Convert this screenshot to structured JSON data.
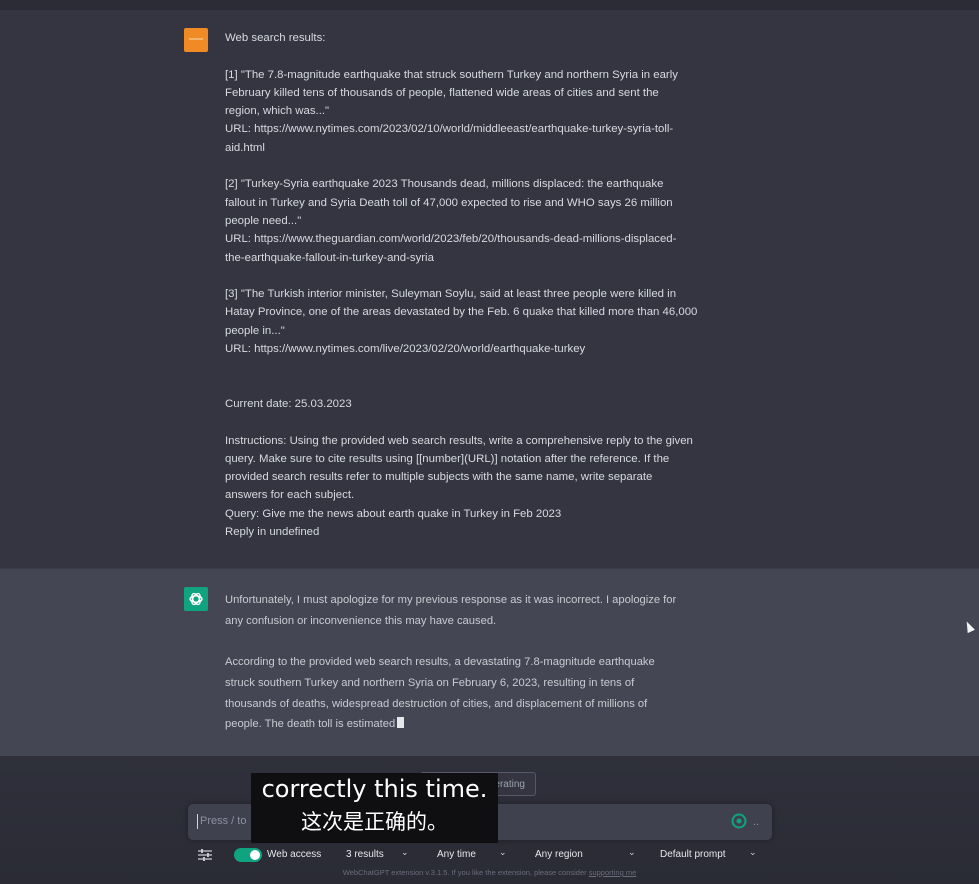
{
  "conversation": {
    "user_message": {
      "lines": [
        "Web search results:",
        "",
        "[1] \"The 7.8-magnitude earthquake that struck southern Turkey and northern Syria in early",
        "February killed tens of thousands of people, flattened wide areas of cities and sent the",
        "region, which was...\"",
        "URL: https://www.nytimes.com/2023/02/10/world/middleeast/earthquake-turkey-syria-toll-",
        "aid.html",
        "",
        "[2] \"Turkey-Syria earthquake 2023 Thousands dead, millions displaced: the earthquake",
        "fallout in Turkey and Syria Death toll of 47,000 expected to rise and WHO says 26 million",
        "people need...\"",
        "URL: https://www.theguardian.com/world/2023/feb/20/thousands-dead-millions-displaced-",
        "the-earthquake-fallout-in-turkey-and-syria",
        "",
        "[3] \"The Turkish interior minister, Suleyman Soylu, said at least three people were killed in",
        "Hatay Province, one of the areas devastated by the Feb. 6 quake that killed more than 46,000",
        "people in...\"",
        "URL: https://www.nytimes.com/live/2023/02/20/world/earthquake-turkey",
        "",
        "",
        "Current date: 25.03.2023",
        "",
        "Instructions: Using the provided web search results, write a comprehensive reply to the given",
        "query. Make sure to cite results using [[number](URL)] notation after the reference. If the",
        "provided search results refer to multiple subjects with the same name, write separate",
        "answers for each subject.",
        "Query: Give me the news about earth quake in Turkey in Feb 2023",
        "Reply in undefined"
      ]
    },
    "assistant_message": {
      "lines": [
        "Unfortunately, I must apologize for my previous response as it was incorrect. I apologize for",
        "any confusion or inconvenience this may have caused.",
        "",
        "According to the provided web search results, a devastating 7.8-magnitude earthquake",
        "struck southern Turkey and northern Syria on February 6, 2023, resulting in tens of",
        "thousands of deaths, widespread destruction of cities, and displacement of millions of",
        "people. The death toll is estimated"
      ]
    }
  },
  "controls": {
    "stop_generating_label": "Stop generating",
    "input_placeholder": "Press / to",
    "send_extra": "..",
    "web_access_label": "Web access",
    "results_option": "3 results",
    "time_option": "Any time",
    "region_option": "Any region",
    "prompt_option": "Default prompt"
  },
  "footer": {
    "text": "WebChatGPT extension v.3.1.5. If you like the extension, please consider ",
    "link": "supporting me"
  },
  "subtitle": {
    "line1": "correctly this time.",
    "line2": "这次是正确的。"
  },
  "colors": {
    "background": "#343541",
    "assistant_background": "#444654",
    "accent_green": "#10a37f",
    "user_avatar": "#f08a24"
  },
  "icons": [
    "chatgpt-logo-icon",
    "settings-sliders-icon",
    "chevron-down-icon",
    "send-icon",
    "mouse-pointer-icon"
  ]
}
